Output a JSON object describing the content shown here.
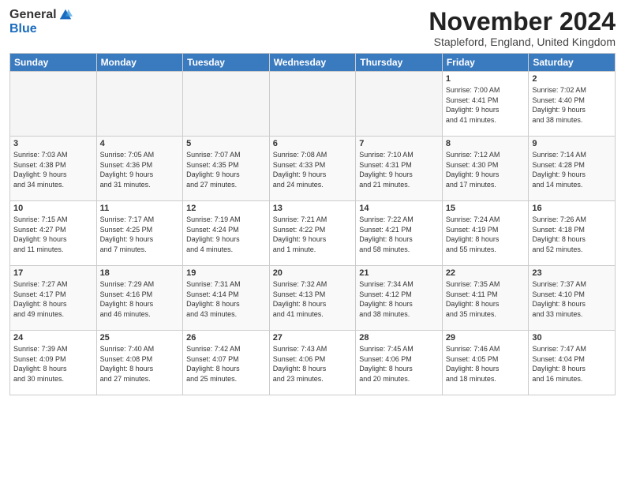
{
  "logo": {
    "general": "General",
    "blue": "Blue"
  },
  "title": "November 2024",
  "location": "Stapleford, England, United Kingdom",
  "headers": [
    "Sunday",
    "Monday",
    "Tuesday",
    "Wednesday",
    "Thursday",
    "Friday",
    "Saturday"
  ],
  "weeks": [
    [
      {
        "day": "",
        "info": ""
      },
      {
        "day": "",
        "info": ""
      },
      {
        "day": "",
        "info": ""
      },
      {
        "day": "",
        "info": ""
      },
      {
        "day": "",
        "info": ""
      },
      {
        "day": "1",
        "info": "Sunrise: 7:00 AM\nSunset: 4:41 PM\nDaylight: 9 hours\nand 41 minutes."
      },
      {
        "day": "2",
        "info": "Sunrise: 7:02 AM\nSunset: 4:40 PM\nDaylight: 9 hours\nand 38 minutes."
      }
    ],
    [
      {
        "day": "3",
        "info": "Sunrise: 7:03 AM\nSunset: 4:38 PM\nDaylight: 9 hours\nand 34 minutes."
      },
      {
        "day": "4",
        "info": "Sunrise: 7:05 AM\nSunset: 4:36 PM\nDaylight: 9 hours\nand 31 minutes."
      },
      {
        "day": "5",
        "info": "Sunrise: 7:07 AM\nSunset: 4:35 PM\nDaylight: 9 hours\nand 27 minutes."
      },
      {
        "day": "6",
        "info": "Sunrise: 7:08 AM\nSunset: 4:33 PM\nDaylight: 9 hours\nand 24 minutes."
      },
      {
        "day": "7",
        "info": "Sunrise: 7:10 AM\nSunset: 4:31 PM\nDaylight: 9 hours\nand 21 minutes."
      },
      {
        "day": "8",
        "info": "Sunrise: 7:12 AM\nSunset: 4:30 PM\nDaylight: 9 hours\nand 17 minutes."
      },
      {
        "day": "9",
        "info": "Sunrise: 7:14 AM\nSunset: 4:28 PM\nDaylight: 9 hours\nand 14 minutes."
      }
    ],
    [
      {
        "day": "10",
        "info": "Sunrise: 7:15 AM\nSunset: 4:27 PM\nDaylight: 9 hours\nand 11 minutes."
      },
      {
        "day": "11",
        "info": "Sunrise: 7:17 AM\nSunset: 4:25 PM\nDaylight: 9 hours\nand 7 minutes."
      },
      {
        "day": "12",
        "info": "Sunrise: 7:19 AM\nSunset: 4:24 PM\nDaylight: 9 hours\nand 4 minutes."
      },
      {
        "day": "13",
        "info": "Sunrise: 7:21 AM\nSunset: 4:22 PM\nDaylight: 9 hours\nand 1 minute."
      },
      {
        "day": "14",
        "info": "Sunrise: 7:22 AM\nSunset: 4:21 PM\nDaylight: 8 hours\nand 58 minutes."
      },
      {
        "day": "15",
        "info": "Sunrise: 7:24 AM\nSunset: 4:19 PM\nDaylight: 8 hours\nand 55 minutes."
      },
      {
        "day": "16",
        "info": "Sunrise: 7:26 AM\nSunset: 4:18 PM\nDaylight: 8 hours\nand 52 minutes."
      }
    ],
    [
      {
        "day": "17",
        "info": "Sunrise: 7:27 AM\nSunset: 4:17 PM\nDaylight: 8 hours\nand 49 minutes."
      },
      {
        "day": "18",
        "info": "Sunrise: 7:29 AM\nSunset: 4:16 PM\nDaylight: 8 hours\nand 46 minutes."
      },
      {
        "day": "19",
        "info": "Sunrise: 7:31 AM\nSunset: 4:14 PM\nDaylight: 8 hours\nand 43 minutes."
      },
      {
        "day": "20",
        "info": "Sunrise: 7:32 AM\nSunset: 4:13 PM\nDaylight: 8 hours\nand 41 minutes."
      },
      {
        "day": "21",
        "info": "Sunrise: 7:34 AM\nSunset: 4:12 PM\nDaylight: 8 hours\nand 38 minutes."
      },
      {
        "day": "22",
        "info": "Sunrise: 7:35 AM\nSunset: 4:11 PM\nDaylight: 8 hours\nand 35 minutes."
      },
      {
        "day": "23",
        "info": "Sunrise: 7:37 AM\nSunset: 4:10 PM\nDaylight: 8 hours\nand 33 minutes."
      }
    ],
    [
      {
        "day": "24",
        "info": "Sunrise: 7:39 AM\nSunset: 4:09 PM\nDaylight: 8 hours\nand 30 minutes."
      },
      {
        "day": "25",
        "info": "Sunrise: 7:40 AM\nSunset: 4:08 PM\nDaylight: 8 hours\nand 27 minutes."
      },
      {
        "day": "26",
        "info": "Sunrise: 7:42 AM\nSunset: 4:07 PM\nDaylight: 8 hours\nand 25 minutes."
      },
      {
        "day": "27",
        "info": "Sunrise: 7:43 AM\nSunset: 4:06 PM\nDaylight: 8 hours\nand 23 minutes."
      },
      {
        "day": "28",
        "info": "Sunrise: 7:45 AM\nSunset: 4:06 PM\nDaylight: 8 hours\nand 20 minutes."
      },
      {
        "day": "29",
        "info": "Sunrise: 7:46 AM\nSunset: 4:05 PM\nDaylight: 8 hours\nand 18 minutes."
      },
      {
        "day": "30",
        "info": "Sunrise: 7:47 AM\nSunset: 4:04 PM\nDaylight: 8 hours\nand 16 minutes."
      }
    ]
  ]
}
